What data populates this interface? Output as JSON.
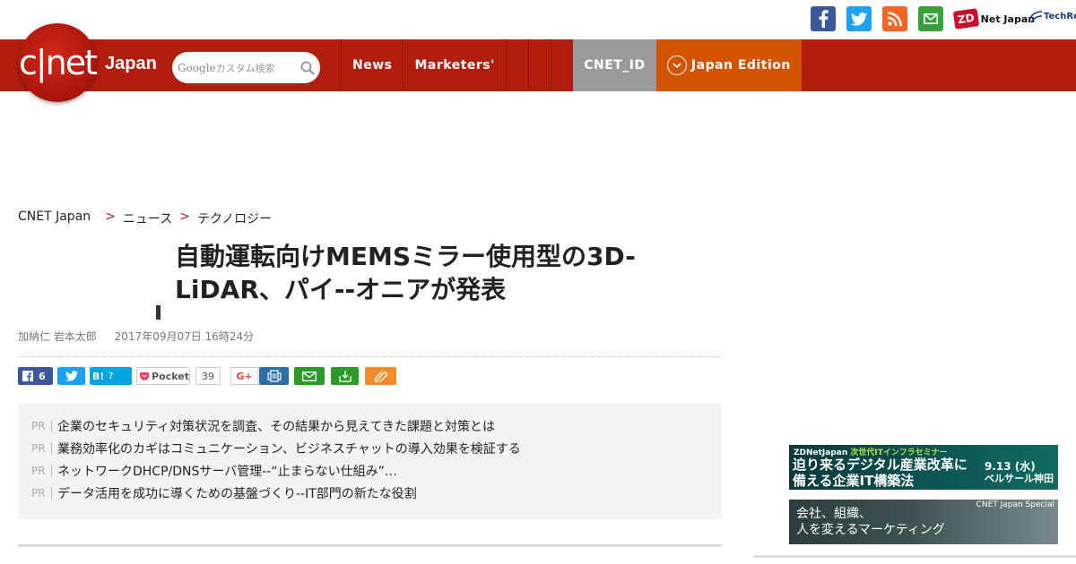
{
  "topbar": {
    "icons": [
      "facebook-icon",
      "twitter-icon",
      "rss-icon",
      "mail-icon"
    ],
    "zdnet_badge": "ZD",
    "zdnet_label": "Net Japan",
    "techrep_label": "TechRep"
  },
  "brand": {
    "logo_text": "c|net",
    "logo_suffix": "Japan",
    "accent": "#b11e0e"
  },
  "search": {
    "placeholder_brand": "Google",
    "placeholder": "カスタム検索"
  },
  "nav": {
    "items": [
      "News",
      "Marketers'"
    ],
    "cnet_id": "CNET_ID",
    "edition": "Japan Edition",
    "edition_color": "#d35400",
    "cnet_id_color": "#9a9a9a"
  },
  "breadcrumb": {
    "home": "CNET Japan",
    "sep": ">",
    "level1": "ニュース",
    "level2": "テクノロジー"
  },
  "article": {
    "title": "自動運転向けMEMSミラー使用型の3D-LiDAR、パイ--オニアが発表",
    "author": "加納仁 岩本太郎",
    "date": "2017年09月07日 16時24分"
  },
  "share": {
    "facebook_count": "6",
    "hatena_label": "B!",
    "hatena_count": "7",
    "pocket_label": "Pocket",
    "pocket_count": "39",
    "gplus_label": "G+"
  },
  "pr": {
    "tag": "PR",
    "items": [
      "企業のセキュリティ対策状況を調査、その結果から見えてきた課題と対策とは",
      "業務効率化のカギはコミュニケーション、ビジネスチャットの導入効果を検証する",
      "ネットワークDHCP/DNSサーバ管理--“止まらない仕組み”を実現するにはどうすれば…",
      "データ活用を成功に導くための基盤づくり--IT部門の新たな役割"
    ]
  },
  "banners": {
    "b1_brand": "ZDNetJapan",
    "b1_series": "次世代ITインフラセミナー",
    "b1_line1": "迫り来るデジタル産業改革に",
    "b1_line2": "備える企業IT構築法",
    "b1_date": "9.13 (水)",
    "b1_venue": "ベルサール神田",
    "b2_tag": "CNET Japan Special",
    "b2_line1": "会社、組織、",
    "b2_line2": "人を変えるマーケティング"
  }
}
